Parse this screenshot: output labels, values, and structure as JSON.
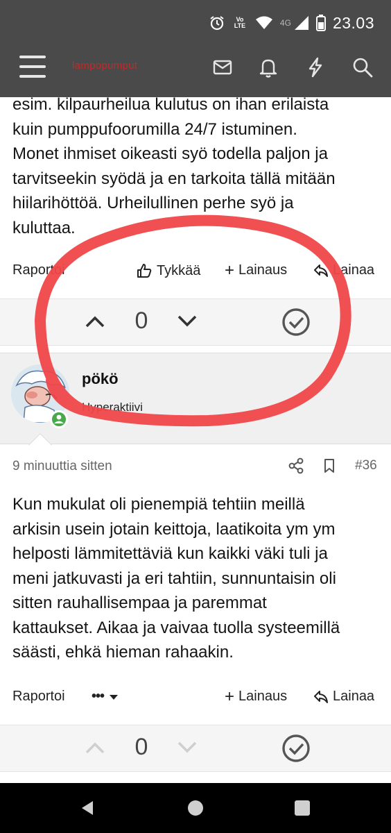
{
  "status_bar": {
    "time": "23.03",
    "network": "4G",
    "volte": "Vo LTE"
  },
  "header": {
    "site_title": "lampopumput",
    "icons": [
      "menu-icon",
      "inbox-icon",
      "bell-icon",
      "lightning-icon",
      "search-icon"
    ]
  },
  "previous_post": {
    "text_lines": [
      "esim. kilpaurheilua kulutus on ihan erilaista",
      "kuin pumppufoorumilla 24/7 istuminen.",
      "Monet ihmiset oikeasti syö todella paljon ja",
      "tarvitseekin syödä ja en tarkoita tällä mitään",
      "hiilarihöttöä. Urheilullinen perhe syö ja",
      "kuluttaa."
    ],
    "actions": {
      "report": "Raportoi",
      "like": "Tykkää",
      "quote": "Lainaus",
      "reply": "Lainaa"
    },
    "vote_score": "0"
  },
  "post": {
    "author": {
      "name": "pökö",
      "role": "Hyperaktiivi"
    },
    "time": "9 minuuttia sitten",
    "number": "#36",
    "text_lines": [
      "Kun mukulat oli pienempiä tehtiin meillä",
      "arkisin usein jotain keittoja, laatikoita ym ym",
      "helposti lämmitettäviä kun kaikki väki tuli ja",
      "meni jatkuvasti ja eri tahtiin, sunnuntaisin oli",
      "sitten rauhallisempaa ja paremmat",
      "kattaukset. Aikaa ja vaivaa tuolla systeemillä",
      "säästi, ehkä hieman rahaakin."
    ],
    "actions": {
      "report": "Raportoi",
      "more": "•••",
      "quote": "Lainaus",
      "reply": "Lainaa"
    },
    "vote_score": "0"
  },
  "colors": {
    "appbar": "#4a4a4a",
    "site_title": "#c62828",
    "annotation_circle": "#f0474a",
    "online_badge": "#49a84b"
  }
}
